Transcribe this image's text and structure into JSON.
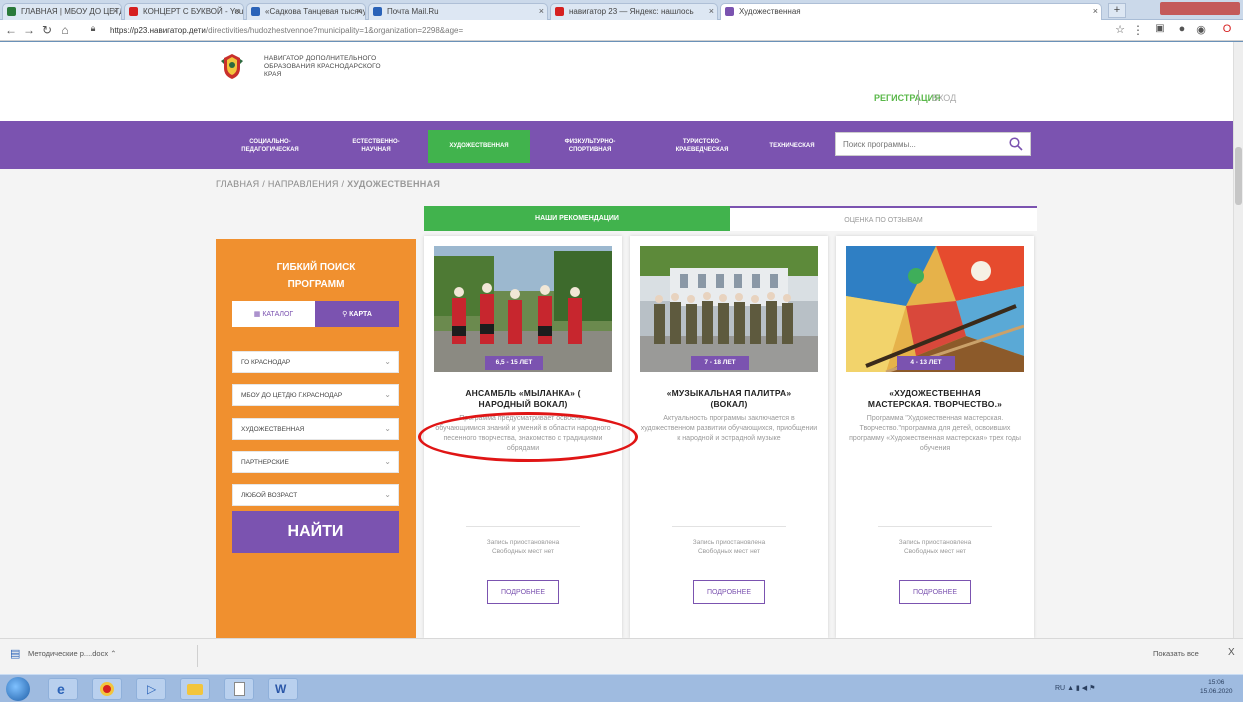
{
  "browser": {
    "tabs": [
      {
        "label": "ГЛАВНАЯ | МБОУ ДО ЦЕТДЮ",
        "color": "#2b7a3b"
      },
      {
        "label": "КОНЦЕРТ С БУКВОЙ - YouTube",
        "color": "#d62020"
      },
      {
        "label": "«Садкова Танцевая тысячу…»",
        "color": "#2b63b8"
      },
      {
        "label": "Почта Mail.Ru",
        "color": "#2b63b8"
      },
      {
        "label": "навигатор 23 — Яндекс: нашлось",
        "color": "#d62020"
      },
      {
        "label": "Художественная",
        "color": "#7b53b0"
      }
    ],
    "url_host": "https://p23.навигатор.дети",
    "url_path": "/directivities/hudozhestvennoe?municipality=1&organization=2298&age="
  },
  "site": {
    "logo_lines": [
      "НАВИГАТОР ДОПОЛНИТЕЛЬНОГО",
      "ОБРАЗОВАНИЯ КРАСНОДАРСКОГО",
      "КРАЯ"
    ],
    "register": "РЕГИСТРАЦИЯ",
    "login": "ВХОД"
  },
  "nav": {
    "items": [
      {
        "line1": "СОЦИАЛЬНО-",
        "line2": "ПЕДАГОГИЧЕСКАЯ"
      },
      {
        "line1": "ЕСТЕСТВЕННО-",
        "line2": "НАУЧНАЯ"
      },
      {
        "line1": "ХУДОЖЕСТВЕННАЯ",
        "line2": ""
      },
      {
        "line1": "ФИЗКУЛЬТУРНО-",
        "line2": "СПОРТИВНАЯ"
      },
      {
        "line1": "ТУРИСТСКО-",
        "line2": "КРАЕВЕДЧЕСКАЯ"
      },
      {
        "line1": "ТЕХНИЧЕСКАЯ",
        "line2": ""
      }
    ],
    "search_placeholder": "Поиск программы..."
  },
  "breadcrumb": {
    "home": "ГЛАВНАЯ",
    "sep": "/",
    "section": "НАПРАВЛЕНИЯ",
    "current": "ХУДОЖЕСТВЕННАЯ"
  },
  "rec_tabs": {
    "active": "НАШИ РЕКОМЕНДАЦИИ",
    "inactive": "ОЦЕНКА ПО ОТЗЫВАМ"
  },
  "filter": {
    "title_line1": "ГИБКИЙ ПОИСК",
    "title_line2": "ПРОГРАММ",
    "catalog": "КАТАЛОГ",
    "map": "КАРТА",
    "selects": [
      "ГО КРАСНОДАР",
      "МБОУ ДО ЦЕТДЮ Г.КРАСНОДАР",
      "ХУДОЖЕСТВЕННАЯ",
      "ПАРТНЕРСКИЕ",
      "ЛЮБОЙ ВОЗРАСТ"
    ],
    "find": "НАЙТИ"
  },
  "cards": [
    {
      "age": "6,5 - 15 ЛЕТ",
      "title1": "АНСАМБЛЬ «МЫЛАНКА» (",
      "title2": "НАРОДНЫЙ ВОКАЛ)",
      "desc": "Программа предусматривает освоение обучающимися знаний и умений в области народного песенного творчества, знакомство с традициями обрядами",
      "status1": "Запись приостановлена",
      "status2": "Свободных мест нет",
      "button": "ПОДРОБНЕЕ"
    },
    {
      "age": "7 - 18 ЛЕТ",
      "title1": "«МУЗЫКАЛЬНАЯ ПАЛИТРА»",
      "title2": "(ВОКАЛ)",
      "desc": "Актуальность программы заключается в художественном развитии обучающихся, приобщении к народной и эстрадной музыке",
      "status1": "Запись приостановлена",
      "status2": "Свободных мест нет",
      "button": "ПОДРОБНЕЕ"
    },
    {
      "age": "4 - 13 ЛЕТ",
      "title1": "«ХУДОЖЕСТВЕННАЯ",
      "title2": "МАСТЕРСКАЯ. ТВОРЧЕСТВО.»",
      "desc": "Программа \"Художественная мастерская. Творчество.\"программа для детей, освоивших программу «Художественная мастерская» трех годы обучения",
      "status1": "Запись приостановлена",
      "status2": "Свободных мест нет",
      "button": "ПОДРОБНЕЕ"
    }
  ],
  "downloads": {
    "item": "Методические р....docx",
    "show_all": "Показать все",
    "close": "X"
  },
  "taskbar": {
    "tray": "RU",
    "time": "15:06",
    "date": "15.06.2020"
  },
  "colors": {
    "purple": "#7b53b0",
    "green": "#41b34d",
    "orange": "#f0902f",
    "annotation_red": "#e01515"
  }
}
